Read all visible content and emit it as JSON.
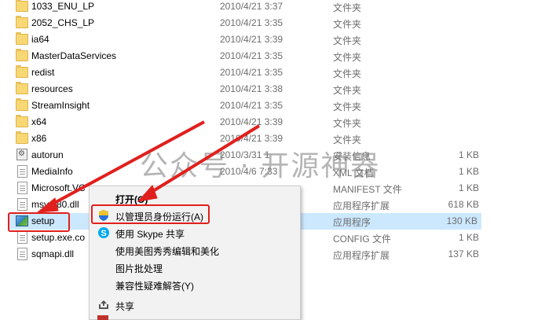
{
  "files": [
    {
      "name": "1033_ENU_LP",
      "date": "2010/4/21 3:37",
      "type": "文件夹",
      "size": "",
      "icon": "folder-icon"
    },
    {
      "name": "2052_CHS_LP",
      "date": "2010/4/21 3:35",
      "type": "文件夹",
      "size": "",
      "icon": "folder-icon"
    },
    {
      "name": "ia64",
      "date": "2010/4/21 3:39",
      "type": "文件夹",
      "size": "",
      "icon": "folder-icon"
    },
    {
      "name": "MasterDataServices",
      "date": "2010/4/21 3:35",
      "type": "文件夹",
      "size": "",
      "icon": "folder-icon"
    },
    {
      "name": "redist",
      "date": "2010/4/21 3:35",
      "type": "文件夹",
      "size": "",
      "icon": "folder-icon"
    },
    {
      "name": "resources",
      "date": "2010/4/21 3:38",
      "type": "文件夹",
      "size": "",
      "icon": "folder-icon"
    },
    {
      "name": "StreamInsight",
      "date": "2010/4/21 3:35",
      "type": "文件夹",
      "size": "",
      "icon": "folder-icon"
    },
    {
      "name": "x64",
      "date": "2010/4/21 3:39",
      "type": "文件夹",
      "size": "",
      "icon": "folder-icon"
    },
    {
      "name": "x86",
      "date": "2010/4/21 3:39",
      "type": "文件夹",
      "size": "",
      "icon": "folder-icon"
    },
    {
      "name": "autorun",
      "date": "2010/3/31 1",
      "type": "安装信息",
      "size": "1 KB",
      "icon": "gear-file-icon"
    },
    {
      "name": "MediaInfo",
      "date": "2010/4/6 7:33",
      "type": "XML 文档",
      "size": "1 KB",
      "icon": "file-icon"
    },
    {
      "name": "Microsoft.VC",
      "date": "",
      "type": "MANIFEST 文件",
      "size": "1 KB",
      "icon": "file-icon"
    },
    {
      "name": "msvcr80.dll",
      "date": "",
      "type": "应用程序扩展",
      "size": "618 KB",
      "icon": "file-icon"
    },
    {
      "name": "setup",
      "date": "",
      "type": "应用程序",
      "size": "130 KB",
      "icon": "setup-icon"
    },
    {
      "name": "setup.exe.co",
      "date": "",
      "type": "CONFIG 文件",
      "size": "1 KB",
      "icon": "file-icon"
    },
    {
      "name": "sqmapi.dll",
      "date": "",
      "type": "应用程序扩展",
      "size": "137 KB",
      "icon": "file-icon"
    }
  ],
  "watermark": "公众号 · 开源神器",
  "context_menu": {
    "open": "打开(O)",
    "run_as_admin": "以管理员身份运行(A)",
    "share_skype": "使用 Skype 共享",
    "meitu": "使用美图秀秀编辑和美化",
    "batch": "图片批处理",
    "compat": "兼容性疑难解答(Y)",
    "share": "共享"
  },
  "colors": {
    "selection": "#cce8ff",
    "highlight_red": "#e0201d",
    "folder": "#f8d775"
  }
}
